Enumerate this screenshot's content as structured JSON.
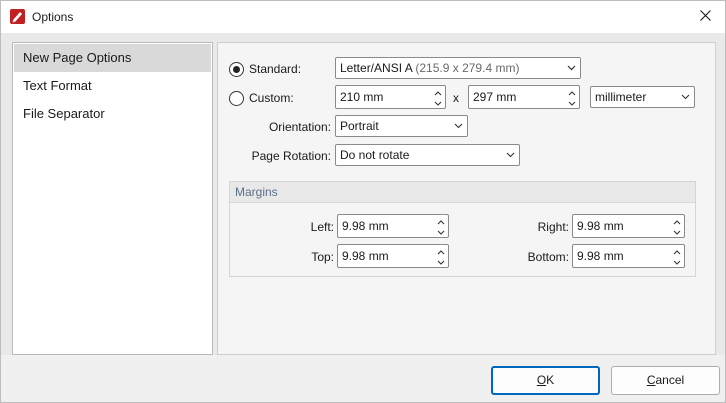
{
  "window": {
    "title": "Options",
    "close_icon": "close-icon",
    "app_icon": "pdf-editor-icon",
    "accent": "#c02020"
  },
  "nav": {
    "items": [
      {
        "label": "New Page Options",
        "selected": true
      },
      {
        "label": "Text Format",
        "selected": false
      },
      {
        "label": "File Separator",
        "selected": false
      }
    ]
  },
  "page": {
    "standard": {
      "label": "Standard:",
      "selected": true,
      "value": "Letter/ANSI A",
      "value_detail": "(215.9 x 279.4 mm)"
    },
    "custom": {
      "label": "Custom:",
      "selected": false,
      "width": "210 mm",
      "separator": "x",
      "height": "297 mm",
      "unit": "millimeter"
    },
    "orientation": {
      "label": "Orientation:",
      "value": "Portrait"
    },
    "rotation": {
      "label": "Page Rotation:",
      "value": "Do not rotate"
    }
  },
  "margins": {
    "title": "Margins",
    "left": {
      "label": "Left:",
      "value": "9.98 mm"
    },
    "right": {
      "label": "Right:",
      "value": "9.98 mm"
    },
    "top": {
      "label": "Top:",
      "value": "9.98 mm"
    },
    "bottom": {
      "label": "Bottom:",
      "value": "9.98 mm"
    }
  },
  "buttons": {
    "ok": {
      "mnemonic": "O",
      "rest": "K"
    },
    "cancel": {
      "mnemonic": "C",
      "rest": "ancel"
    }
  }
}
